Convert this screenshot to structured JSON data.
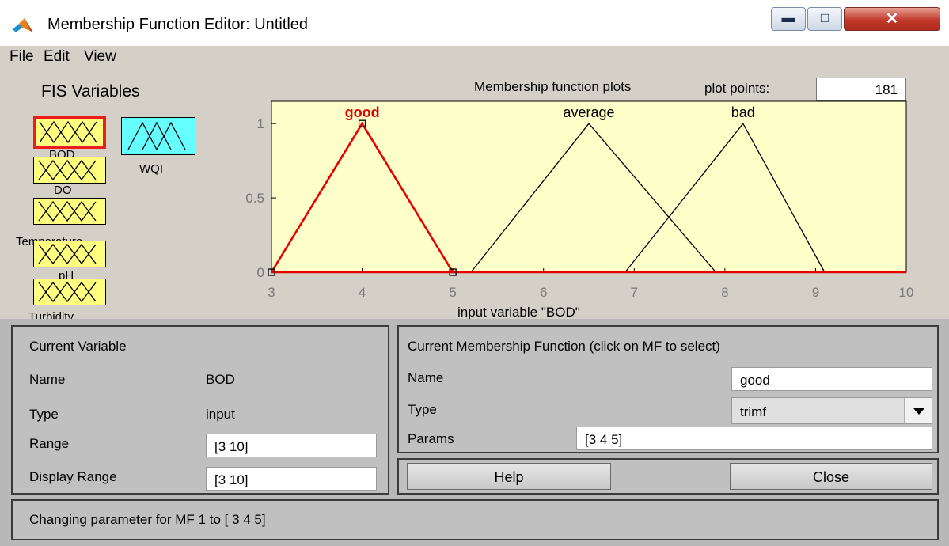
{
  "window": {
    "title": "Membership Function Editor: Untitled"
  },
  "icons": {
    "app": "matlab-logo-icon",
    "minimize": "minimize-icon",
    "maximize": "maximize-icon",
    "close": "close-icon"
  },
  "menu": [
    "File",
    "Edit",
    "View"
  ],
  "fis": {
    "title": "FIS Variables",
    "inputs": [
      "BOD",
      "DO",
      "Temperature",
      "pH",
      "Turbidity"
    ],
    "output": "WQI"
  },
  "plot": {
    "title": "Membership function plots",
    "plot_points_label": "plot points:",
    "plot_points": "181",
    "xlabel": "input variable \"BOD\""
  },
  "chart_data": {
    "type": "line",
    "xlim": [
      3,
      10
    ],
    "ylim": [
      0,
      1.15
    ],
    "x_ticks": [
      "3",
      "4",
      "5",
      "6",
      "7",
      "8",
      "9",
      "10"
    ],
    "y_ticks": [
      "0",
      "0.5",
      "1"
    ],
    "selected_color": "#e60000",
    "series": [
      {
        "name": "good",
        "mf": "trimf",
        "params": [
          3,
          4,
          5
        ],
        "selected": true
      },
      {
        "name": "average",
        "mf": "trimf",
        "params": [
          5.2,
          6.5,
          7.9
        ],
        "selected": false
      },
      {
        "name": "bad",
        "mf": "trimf",
        "params": [
          6.9,
          8.2,
          9.1
        ],
        "selected": false
      }
    ]
  },
  "current_variable": {
    "title": "Current Variable",
    "name_label": "Name",
    "name": "BOD",
    "type_label": "Type",
    "type": "input",
    "range_label": "Range",
    "range": "[3 10]",
    "display_range_label": "Display Range",
    "display_range": "[3 10]"
  },
  "current_mf": {
    "title": "Current Membership Function (click on MF to select)",
    "name_label": "Name",
    "name": "good",
    "type_label": "Type",
    "type": "trimf",
    "params_label": "Params",
    "params": "[3 4 5]"
  },
  "buttons": {
    "help": "Help",
    "close": "Close"
  },
  "status": "Changing parameter for MF 1 to  [ 3 4 5]"
}
